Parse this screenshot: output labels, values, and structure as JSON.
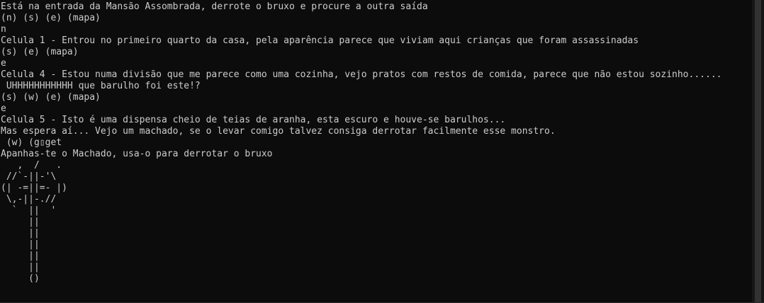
{
  "console": {
    "lines": [
      "Está na entrada da Mansão Assombrada, derrote o bruxo e procure a outra saída",
      "(n) (s) (e) (mapa)",
      "n",
      "Celula 1 - Entrou no primeiro quarto da casa, pela aparência parece que viviam aqui crianças que foram assassinadas",
      "(s) (e) (mapa)",
      "e",
      "Celula 4 - Estou numa divisão que me parece como uma cozinha, vejo pratos com restos de comida, parece que não estou sozinho......",
      " UHHHHHHHHHHH que barulho foi este!?",
      "(s) (w) (e) (mapa)",
      "e",
      "Celula 5 - Isto é uma dispensa cheio de teias de aranha, esta escuro e houve-se barulhos...",
      "Mas espera aí... Vejo um machado, se o levar comigo talvez consiga derrotar facilmente esse monstro.",
      " (w) (g▯get",
      "Apanhas-te o Machado, usa-o para derrotar o bruxo",
      "   ,  /   .",
      " //`-||-'\\",
      "(| -=||=- |)",
      " \\,-||-.//",
      "  `  ||  '",
      "     ||",
      "     ||",
      "     ||",
      "     ||",
      "     ||",
      "     ()"
    ]
  }
}
